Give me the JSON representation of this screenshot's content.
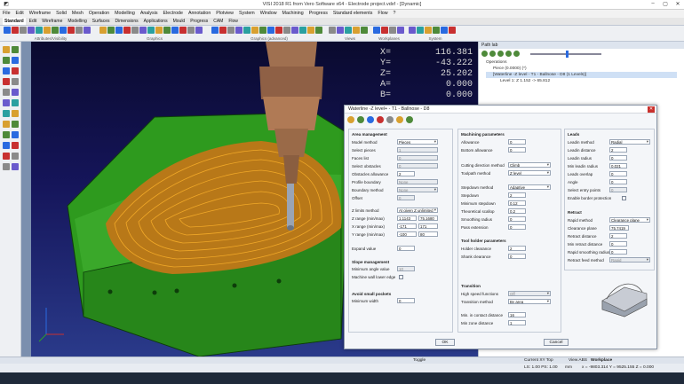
{
  "window": {
    "title": "VISI 2018 R1 from Vero Software x64 - Electrode project.vdxf - [Dynamic]"
  },
  "menu": [
    "File",
    "Edit",
    "Wireframe",
    "Solid",
    "Mesh",
    "Operation",
    "Modelling",
    "Analysis",
    "Electrode",
    "Annotation",
    "Plotview",
    "System",
    "Window",
    "Machining",
    "Progress",
    "Standard elements",
    "Flow",
    "?"
  ],
  "tabs": [
    {
      "label": "Standard",
      "active": true
    },
    {
      "label": "Edit"
    },
    {
      "label": "Wireframe"
    },
    {
      "label": "Modelling"
    },
    {
      "label": "Surfaces"
    },
    {
      "label": "Dimensions"
    },
    {
      "label": "Applications"
    },
    {
      "label": "Mould"
    },
    {
      "label": "Progress"
    },
    {
      "label": "CAM"
    },
    {
      "label": "Flow"
    }
  ],
  "toolbar_groups": [
    "Attributes/Visibility",
    "Graphics",
    "Graphics (advanced)",
    "Views",
    "Workplanes",
    "System"
  ],
  "coords": {
    "X": "116.381",
    "Y": "-43.222",
    "Z": "25.202",
    "A": "0.000",
    "B": "0.000"
  },
  "path_lab": {
    "title": "Path lab",
    "tree": [
      "Operations",
      "Piece (0.0000) (*)",
      "[Waterline -Z level - T1 - Ballnose - D8 (1 Levels)]",
      "Level 1: Z 1.152 -> 65.812"
    ]
  },
  "dialog": {
    "title": "Waterline -Z level+ - T1 - Ballnose - D8",
    "ok": "OK",
    "cancel": "Cancel",
    "area": {
      "title": "Area management",
      "model_method_label": "Model method",
      "model_method": "Pieces",
      "select_pieces": "Select pieces",
      "select_pieces_val": "1",
      "faces_list": "Faces list",
      "faces_list_val": "0",
      "select_obstacles": "Select obstacles",
      "select_obstacles_val": "0",
      "obstacles_allowance": "Obstacles allowance",
      "obstacles_allowance_val": "2",
      "profile_boundary": "Profile boundary",
      "profile_boundary_val": "None",
      "boundary_method": "Boundary method",
      "boundary_method_val": "None",
      "offset": "Offset",
      "offset_val": "0",
      "z_limits_method": "Z limits method",
      "z_limits_method_val": "At given Z unlimited",
      "z_range": "Z range (min/max)",
      "z_min": "1.1143",
      "z_max": "75.1680",
      "x_range": "X range (min/max)",
      "x_min": "-171",
      "x_max": "171",
      "y_range": "Y range (min/max)",
      "y_min": "-100",
      "y_max": "80",
      "expand_value": "Expand value",
      "expand_value_val": "0"
    },
    "slope": {
      "title": "Slope management",
      "min_angle": "Minimum angle value",
      "min_angle_val": "10",
      "machine_lower": "Machine wall lower edge"
    },
    "small": {
      "title": "Avoid small pockets",
      "min_width": "Minimum width",
      "min_width_val": "0"
    },
    "machining": {
      "title": "Machining parameters",
      "allowance": "Allowance",
      "allowance_val": "0",
      "bottom_allowance": "Bottom allowance",
      "bottom_allowance_val": "0",
      "cutting_direction": "Cutting direction method",
      "cutting_direction_val": "Climb",
      "toolpath_method": "Toolpath method",
      "toolpath_method_val": "Z level",
      "stepdown_method": "Stepdown method",
      "stepdown_method_val": "Adaptive",
      "stepdown": "Stepdown",
      "stepdown_val": "2",
      "min_stepdown": "Minimum stepdown",
      "min_stepdown_val": "0.12",
      "theoretical_scallop": "Theoretical scallop",
      "theoretical_scallop_val": "0.2",
      "smoothing_radius": "Smoothing radius",
      "smoothing_radius_val": "0",
      "pass_extension": "Pass extension",
      "pass_extension_val": "0"
    },
    "holder": {
      "title": "Tool holder parameters",
      "holder_clearance": "Holder clearance",
      "holder_clearance_val": "2",
      "shank_clearance": "Shank clearance",
      "shank_clearance_val": "0"
    },
    "transition": {
      "title": "Transition",
      "high_speed": "High speed functions",
      "high_speed_val": "Off",
      "transition_method": "Transition method",
      "transition_method_val": "By area",
      "min_contact": "Min. in contact distance",
      "min_contact_val": "16",
      "min_zone": "Min zone distance",
      "min_zone_val": "1"
    },
    "leads": {
      "title": "Leads",
      "leadin_method": "Leadin method",
      "leadin_method_val": "Radial",
      "leadin_distance": "Leadin distance",
      "leadin_distance_val": "2",
      "leadin_radius": "Leadin radius",
      "leadin_radius_val": "0",
      "min_leadin_radius": "Min leadin radius",
      "min_leadin_radius_val": "0.021",
      "leads_overlap": "Leads overlap",
      "leads_overlap_val": "0",
      "angle": "Angle",
      "angle_val": "0",
      "select_entry": "Select entry points",
      "select_entry_val": "0",
      "enable_border": "Enable border protection"
    },
    "retract": {
      "title": "Retract",
      "rapid_method": "Rapid method",
      "rapid_method_val": "Clearance plane",
      "clearance_plane": "Clearance plane",
      "clearance_plane_val": "75.7419",
      "retract_distance": "Retract distance",
      "retract_distance_val": "2",
      "min_retract": "Min retract distance",
      "min_retract_val": "0",
      "rapid_smoothing": "Rapid smoothing radius",
      "rapid_smoothing_val": "0",
      "retract_feed": "Retract feed method",
      "retract_feed_val": "Rapid"
    }
  },
  "status": {
    "toggle": "Toggle",
    "view": "Current XY Top",
    "viewabs": "View ABS",
    "workplane": "Workplace",
    "scale": "LS: 1.00  PS: 1.00",
    "units": "mm",
    "pointer": "x = -9803.314  Y = 9525.155  Z = 0.000"
  },
  "colors": {
    "part_green": "#2e9a1e",
    "toolpath_orange": "#d08a1a",
    "spindle": "#a07050",
    "bg_top": "#0a0a2e",
    "accent": "#4e8a3a"
  }
}
